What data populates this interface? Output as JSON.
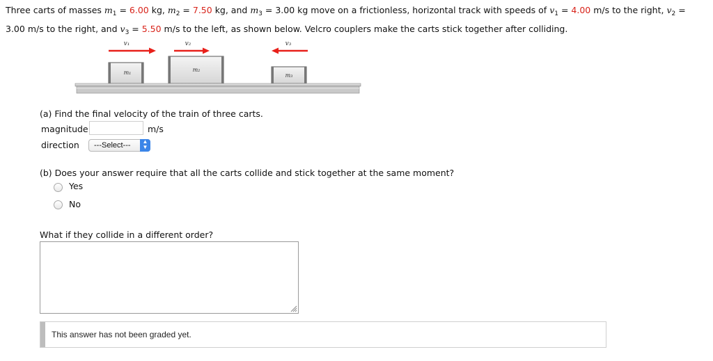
{
  "problem": {
    "t1": "Three carts of masses ",
    "m1_sym": "m",
    "m1_sub": "1",
    "eq1": " = ",
    "m1_val": "6.00",
    "t2": " kg, ",
    "m2_sym": "m",
    "m2_sub": "2",
    "eq2": " = ",
    "m2_val": "7.50",
    "t3": " kg, and ",
    "m3_sym": "m",
    "m3_sub": "3",
    "eq3": " = 3.00 kg move on a frictionless, horizontal track with speeds of ",
    "v1_sym": "v",
    "v1_sub": "1",
    "eq4": " = ",
    "v1_val": "4.00",
    "t4": " m/s to the right, ",
    "v2_sym": "v",
    "v2_sub": "2",
    "eq5": " = 3.00",
    "t5": " m/s to the right, and ",
    "v3_sym": "v",
    "v3_sub": "3",
    "eq6": " = ",
    "v3_val": "5.50",
    "t6": " m/s to the left, as shown below. Velcro couplers make the carts stick together after colliding."
  },
  "figure": {
    "v1_label": "v₁",
    "v2_label": "v₂",
    "v3_label": "v₃",
    "m1_label": "m₁",
    "m2_label": "m₂",
    "m3_label": "m₃",
    "arrow_color": "#e8201a"
  },
  "part_a": {
    "prompt": "(a) Find the final velocity of the train of three carts.",
    "magnitude_label": "magnitude",
    "magnitude_value": "",
    "unit": "m/s",
    "direction_label": "direction",
    "direction_selected": "---Select---"
  },
  "part_b": {
    "prompt": "(b) Does your answer require that all the carts collide and stick together at the same moment?",
    "options": [
      "Yes",
      "No"
    ]
  },
  "what_if": {
    "prompt": "What if they collide in a different order?",
    "answer_value": ""
  },
  "grading": {
    "message": "This answer has not been graded yet."
  },
  "colors": {
    "highlight": "#d8231a",
    "select_accent": "#3b85e8"
  }
}
